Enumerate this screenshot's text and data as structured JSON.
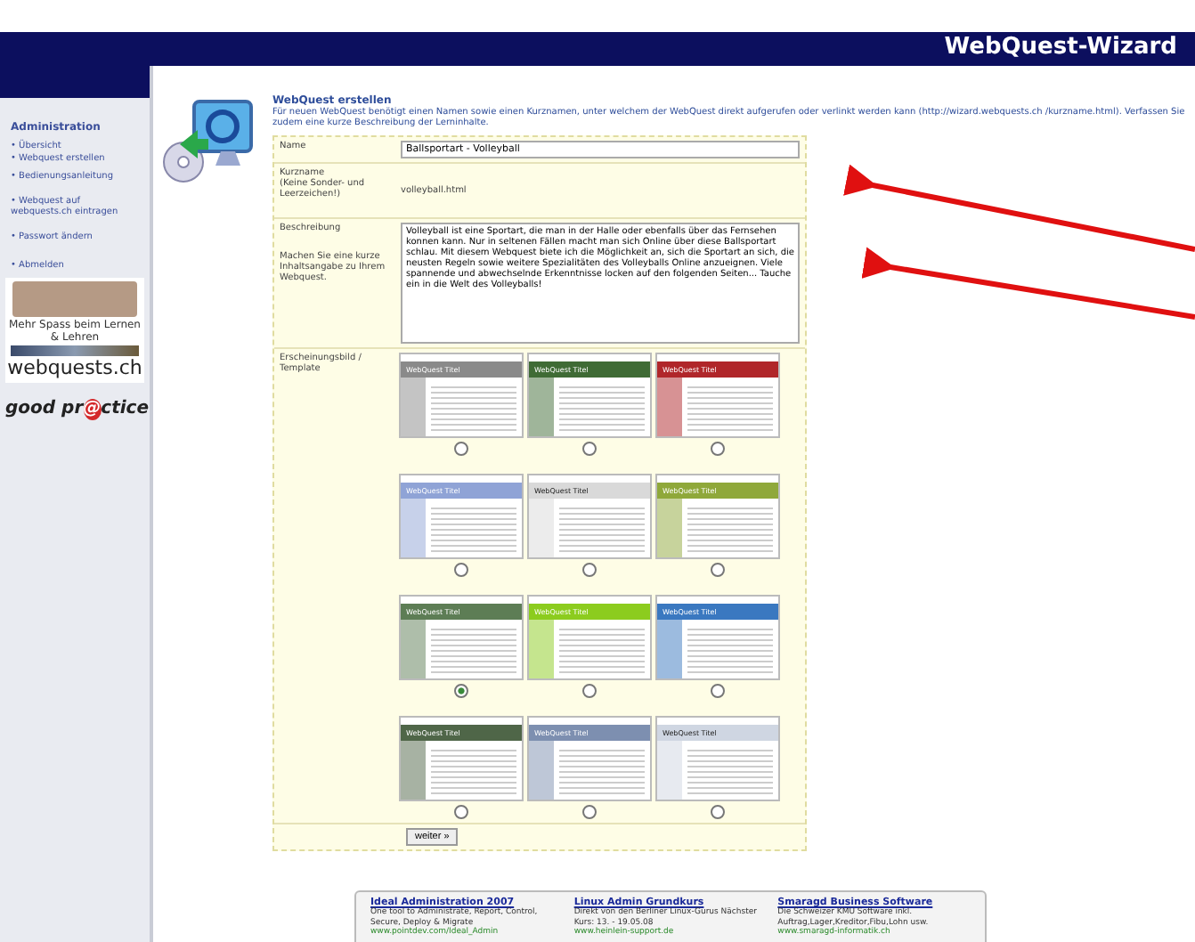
{
  "header": {
    "title": "WebQuest-Wizard"
  },
  "sidebar": {
    "heading": "Administration",
    "items": [
      {
        "label": "• Übersicht"
      },
      {
        "label": "• Webquest erstellen"
      },
      {
        "label": "• Bedienungsanleitung"
      },
      {
        "label": "• Webquest auf webquests.ch eintragen"
      },
      {
        "label": "• Passwort ändern"
      },
      {
        "label": "• Abmelden"
      }
    ],
    "banner": {
      "slogan": "Mehr Spass beim Lernen & Lehren",
      "site": "webquests.ch"
    },
    "logo": {
      "before": "good pr",
      "at": "@",
      "after": "ctice"
    }
  },
  "intro": {
    "title": "WebQuest erstellen",
    "text": "Für neuen WebQuest benötigt einen Namen sowie einen Kurznamen, unter welchem der WebQuest direkt aufgerufen oder verlinkt werden kann (http://wizard.webquests.ch /kurzname.html). Verfassen Sie zudem eine kurze Beschreibung der Lerninhalte."
  },
  "form": {
    "name": {
      "label": "Name",
      "value": "Ballsportart - Volleyball"
    },
    "shortname": {
      "label": "Kurzname",
      "hint": "(Keine Sonder- und Leerzeichen!)",
      "value": "volleyball.html"
    },
    "description": {
      "label": "Beschreibung",
      "hint": "Machen Sie eine kurze Inhaltsangabe zu Ihrem Webquest.",
      "value": "Volleyball ist eine Sportart, die man in der Halle oder ebenfalls über das Fernsehen konnen kann. Nur in seltenen Fällen macht man sich Online über diese Ballsportart schlau. Mit diesem Webquest biete ich die Möglichkeit an, sich die Sportart an sich, die neusten Regeln sowie weitere Spezialitäten des Volleyballs Online anzueignen. Viele spannende und abwechselnde Erkenntnisse locken auf den folgenden Seiten... Tauche ein in die Welt des Volleyballs!"
    },
    "template": {
      "label": "Erscheinungsbild / Template",
      "options": [
        {
          "title": "WebQuest Titel",
          "color": "#8a8a8a",
          "selected": false
        },
        {
          "title": "WebQuest Titel",
          "color": "#3f6b35",
          "selected": false
        },
        {
          "title": "WebQuest Titel",
          "color": "#b0262a",
          "selected": false
        },
        {
          "title": "WebQuest Titel",
          "color": "#8fa3d6",
          "selected": false
        },
        {
          "title": "WebQuest Titel",
          "color": "#d9d9d9",
          "selected": false
        },
        {
          "title": "WebQuest Titel",
          "color": "#8fa83a",
          "selected": false
        },
        {
          "title": "WebQuest Titel",
          "color": "#5d7d55",
          "selected": true
        },
        {
          "title": "WebQuest Titel",
          "color": "#8ccc1e",
          "selected": false
        },
        {
          "title": "WebQuest Titel",
          "color": "#3a78c0",
          "selected": false
        },
        {
          "title": "WebQuest Titel",
          "color": "#4f6648",
          "selected": false
        },
        {
          "title": "WebQuest Titel",
          "color": "#7d8fb0",
          "selected": false
        },
        {
          "title": "WebQuest Titel",
          "color": "#cfd6e2",
          "selected": false
        }
      ]
    },
    "submit": "weiter »"
  },
  "ads": [
    {
      "title": "Ideal Administration 2007",
      "text": "One tool to Administrate, Report, Control, Secure, Deploy & Migrate",
      "url": "www.pointdev.com/Ideal_Admin"
    },
    {
      "title": "Linux Admin Grundkurs",
      "text": "Direkt von den Berliner Linux-Gurus Nächster Kurs: 13. - 19.05.08",
      "url": "www.heinlein-support.de"
    },
    {
      "title": "Smaragd Business Software",
      "text": "Die Schweizer KMU Software inkl. Auftrag,Lager,Kreditor,Fibu,Lohn usw.",
      "url": "www.smaragd-informatik.ch"
    }
  ]
}
